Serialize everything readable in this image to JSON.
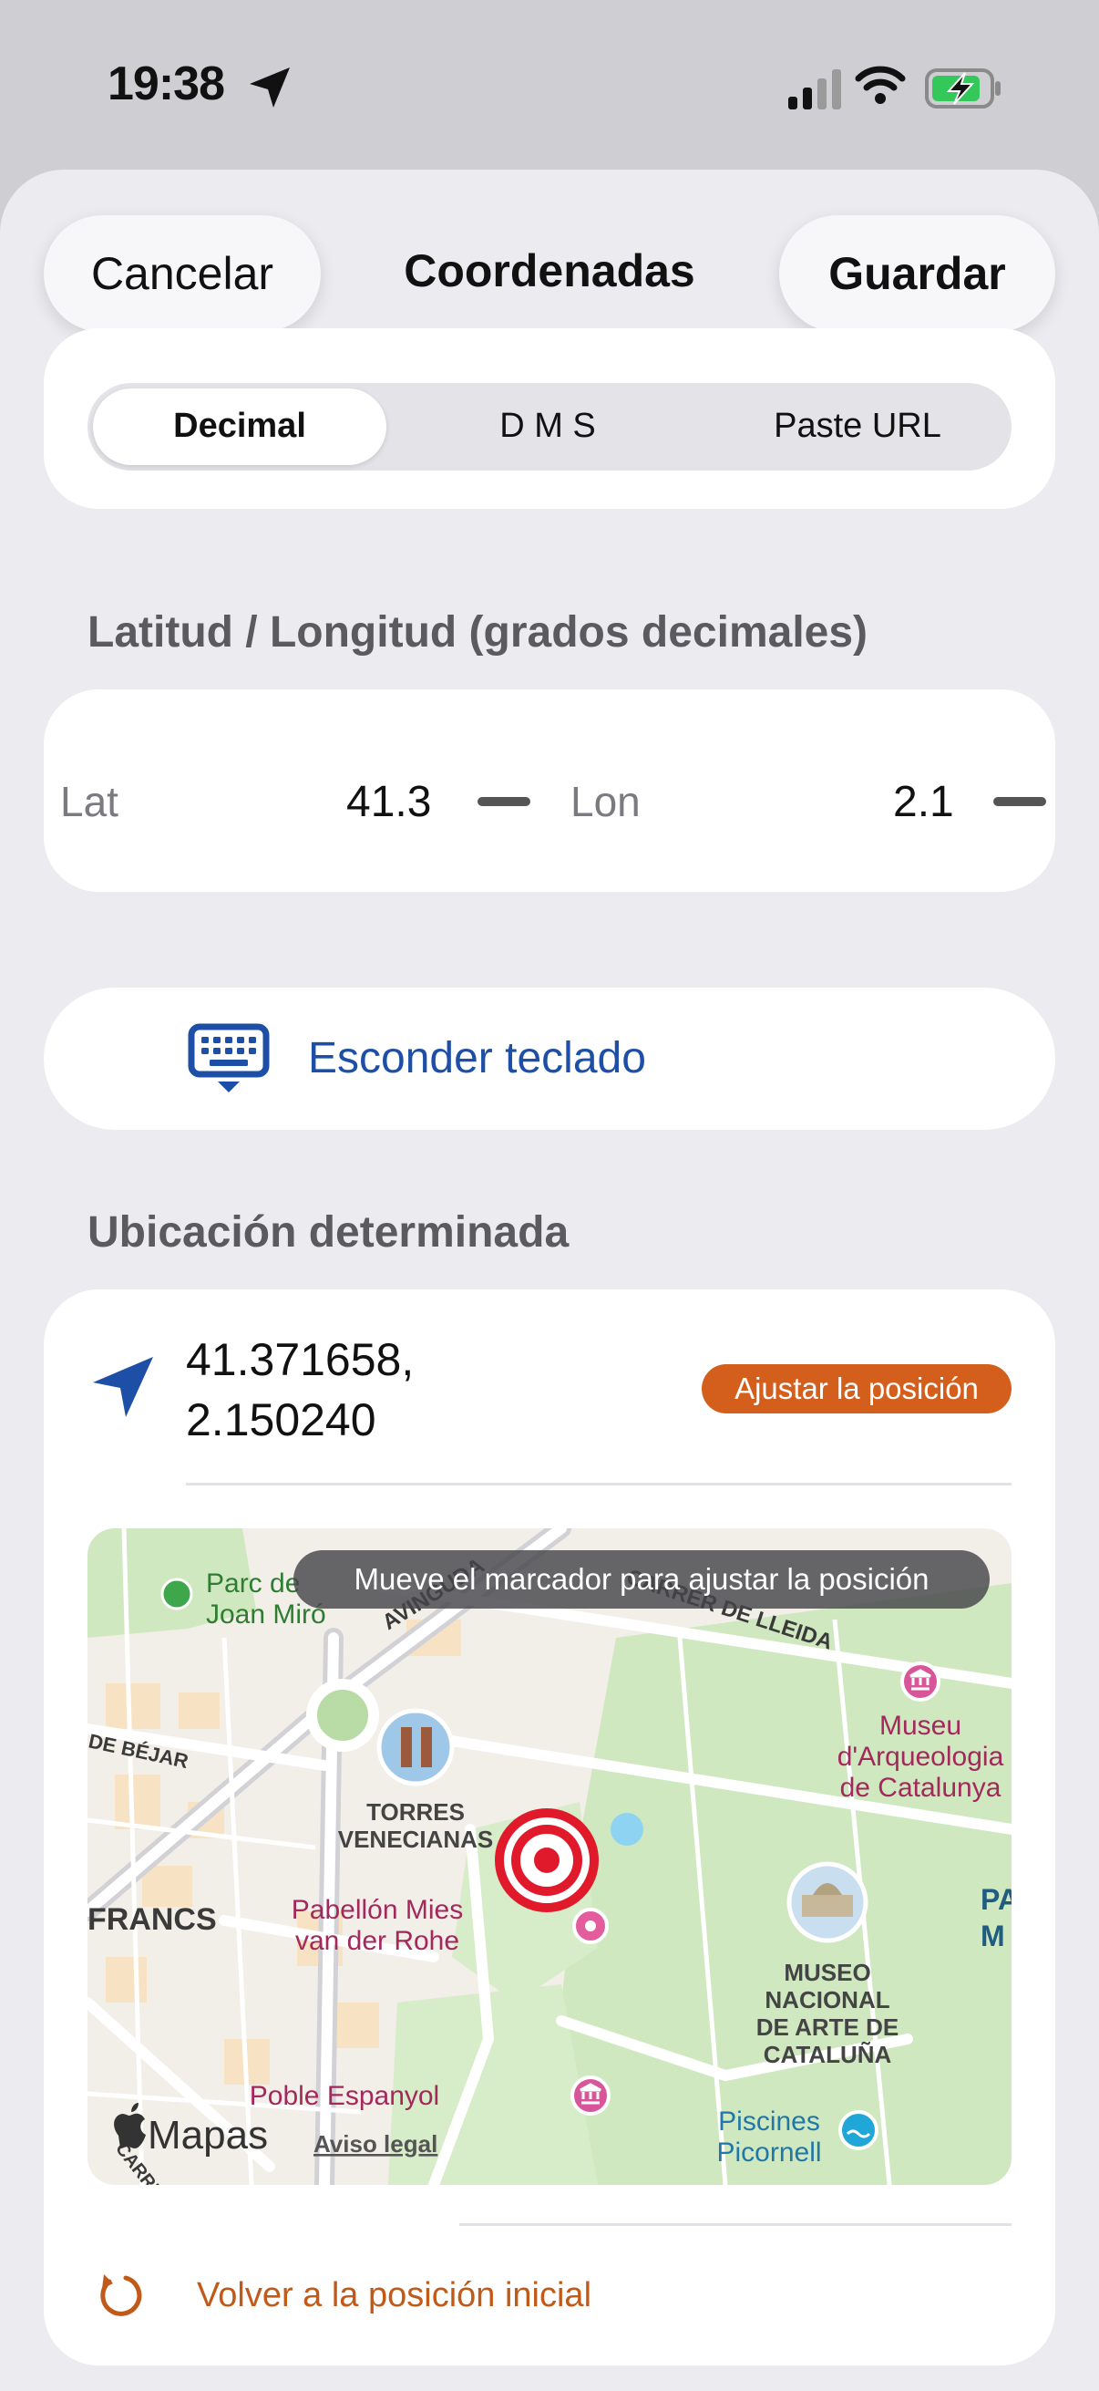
{
  "status_bar": {
    "time": "19:38"
  },
  "nav": {
    "cancel_label": "Cancelar",
    "title": "Coordenadas",
    "save_label": "Guardar"
  },
  "segments": [
    "Decimal",
    "D M S",
    "Paste URL"
  ],
  "coords_section": {
    "header": "Latitud / Longitud (grados decimales)",
    "lat_label": "Lat",
    "lat_value": "41.3",
    "lon_label": "Lon",
    "lon_value": "2.1"
  },
  "keyboard_button": {
    "label": "Esconder teclado"
  },
  "location_section": {
    "header": "Ubicación determinada",
    "coords_line1": "41.371658,",
    "coords_line2": "2.150240",
    "adjust_badge": "Ajustar la posición"
  },
  "map": {
    "hint": "Mueve el marcador para ajustar la posición",
    "labels": {
      "parc1": "Parc de",
      "parc2": "Joan Miró",
      "avinguda": "AVINGUDA",
      "lleida": "CARRER DE LLEIDA",
      "bejar": "DE BÉJAR",
      "torres1": "TORRES",
      "torres2": "VENECIANAS",
      "francs": "FRANCS",
      "mies1": "Pabellón Mies",
      "mies2": "van der Rohe",
      "museu1": "Museu",
      "museu2": "d'Arqueologia",
      "museu3": "de Catalunya",
      "mnac1": "MUSEO",
      "mnac2": "NACIONAL",
      "mnac3": "DE ARTE DE",
      "mnac4": "CATALUÑA",
      "poble": "Poble Espanyol",
      "piscines1": "Piscines",
      "piscines2": "Picornell",
      "morera": "CARRER DEL MORERA",
      "pa": "PA",
      "m": "M",
      "maps_brand": "Mapas",
      "legal": "Aviso legal"
    }
  },
  "reset": {
    "label": "Volver a la posición inicial"
  },
  "colors": {
    "accent_blue": "#1d4fa6",
    "accent_orange": "#d45e1c",
    "marker_red": "#e0192b"
  }
}
